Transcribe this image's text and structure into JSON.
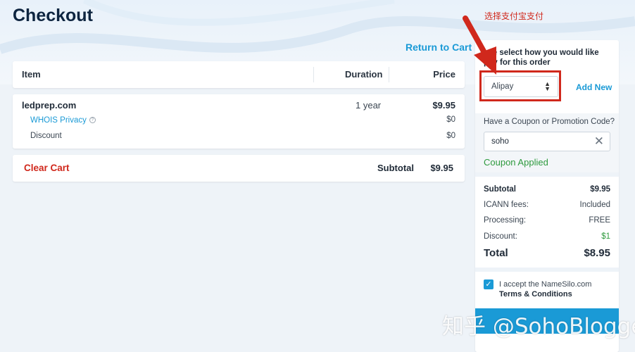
{
  "page": {
    "title": "Checkout",
    "annotation": "选择支付宝支付",
    "return_link": "Return to Cart"
  },
  "table": {
    "headers": {
      "item": "Item",
      "duration": "Duration",
      "price": "Price"
    }
  },
  "cart": {
    "domain": "ledprep.com",
    "duration": "1 year",
    "price": "$9.95",
    "whois_label": "WHOIS Privacy",
    "whois_price": "$0",
    "discount_label": "Discount",
    "discount_price": "$0",
    "clear_label": "Clear Cart",
    "subtotal_label": "Subtotal",
    "subtotal_value": "$9.95"
  },
  "payment": {
    "prompt": "ase select how you would like pay for this order",
    "method": "Alipay",
    "add_new": "Add New",
    "coupon_label": "Have a Coupon or Promotion Code?",
    "coupon_value": "soho",
    "coupon_status": "Coupon Applied"
  },
  "summary": {
    "subtotal_label": "Subtotal",
    "subtotal_value": "$9.95",
    "icann_label": "ICANN fees:",
    "icann_value": "Included",
    "processing_label": "Processing:",
    "processing_value": "FREE",
    "discount_label": "Discount:",
    "discount_value": "$1",
    "total_label": "Total",
    "total_value": "$8.95"
  },
  "terms": {
    "accept_text": "I accept the NameSilo.com",
    "terms_link": "Terms & Conditions"
  },
  "watermark": "知乎 @SohoBlogger",
  "colors": {
    "accent": "#1a9ad6",
    "danger": "#d0281c",
    "success": "#2e9a3e"
  }
}
